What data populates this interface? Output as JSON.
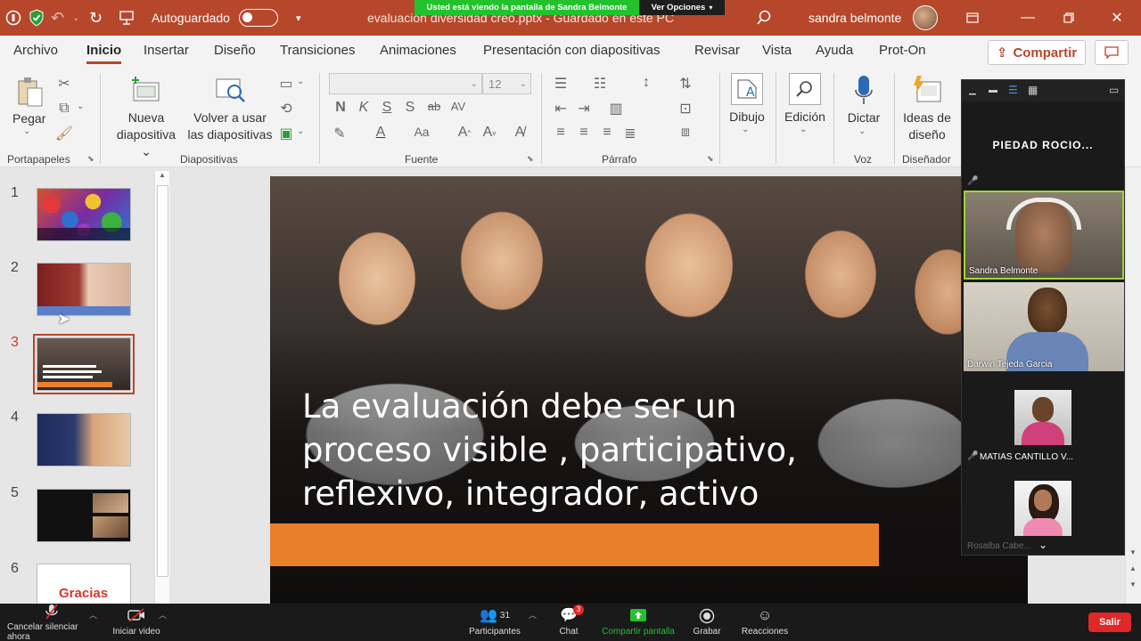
{
  "titlebar": {
    "autosave_label": "Autoguardado",
    "document_title": "evaluación diversidad creo.pptx",
    "save_status": "Guardado en este PC",
    "user_name": "sandra belmonte"
  },
  "zoom_banner": {
    "sharing_text": "Usted está viendo la pantalla de Sandra Belmonte",
    "options_label": "Ver Opciones"
  },
  "menu": {
    "items": [
      "Archivo",
      "Inicio",
      "Insertar",
      "Diseño",
      "Transiciones",
      "Animaciones",
      "Presentación con diapositivas",
      "Revisar",
      "Vista",
      "Ayuda",
      "Prot-On"
    ],
    "share_label": "Compartir"
  },
  "ribbon": {
    "paste_label": "Pegar",
    "new_slide_line1": "Nueva",
    "new_slide_line2": "diapositiva",
    "reuse_line1": "Volver a usar",
    "reuse_line2": "las diapositivas",
    "font_size_value": "12",
    "draw_label": "Dibujo",
    "edit_label": "Edición",
    "dictate_label": "Dictar",
    "design_ideas_line1": "Ideas de",
    "design_ideas_line2": "diseño",
    "groups": {
      "portapapeles": "Portapapeles",
      "diapositivas": "Diapositivas",
      "fuente": "Fuente",
      "parrafo": "Párrafo",
      "voz": "Voz",
      "disenador": "Diseñador"
    },
    "format_letters": [
      "N",
      "K",
      "S",
      "S",
      "ab",
      "AV"
    ]
  },
  "thumbnails": {
    "numbers": [
      "1",
      "2",
      "3",
      "4",
      "5",
      "6"
    ],
    "selected_index": 3,
    "slide6_text": "Gracias"
  },
  "slide": {
    "text_line1": "La evaluación  debe ser un",
    "text_line2": "proceso visible , participativo,",
    "text_line3": "reflexivo, integrador, activo",
    "accent_color": "#e97f2b"
  },
  "zoom_gallery": {
    "header_name": "PIEDAD ROCIO...",
    "participants": [
      {
        "name": "Sandra Belmonte"
      },
      {
        "name": "Darwin Tejeda Garcia"
      },
      {
        "name": "MATIAS CANTILLO V..."
      },
      {
        "name": "Rosalba Cabe..."
      }
    ]
  },
  "zoom_toolbar": {
    "mute_label": "Cancelar silenciar ahora",
    "video_label": "Iniciar video",
    "participants_label": "Participantes",
    "participants_count": "31",
    "chat_label": "Chat",
    "chat_badge": "3",
    "share_label": "Compartir pantalla",
    "record_label": "Grabar",
    "reactions_label": "Reacciones",
    "leave_label": "Salir"
  },
  "colors": {
    "ppt_brand": "#b7472a",
    "zoom_green": "#23c22d",
    "zoom_red": "#e02828"
  }
}
